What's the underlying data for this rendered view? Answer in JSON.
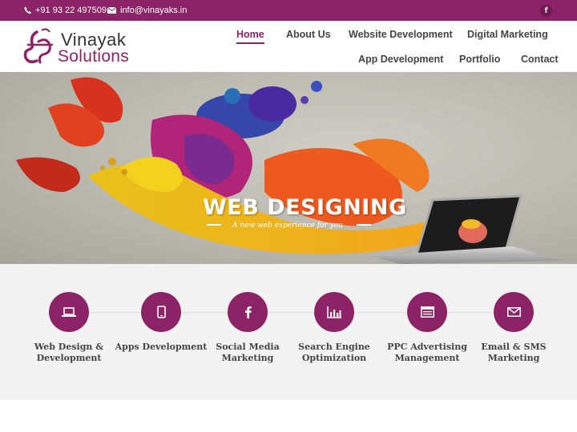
{
  "topbar": {
    "phone": "+91 93 22 497509",
    "email": "info@vinayaks.in",
    "facebook_glyph": "f"
  },
  "logo": {
    "line1": "Vinayak",
    "line2": "Solutions"
  },
  "nav": {
    "items": [
      {
        "label": "Home",
        "active": true
      },
      {
        "label": "About Us"
      },
      {
        "label": "Website Development"
      },
      {
        "label": "Digital Marketing"
      },
      {
        "label": "App Development"
      },
      {
        "label": "Portfolio"
      },
      {
        "label": "Contact"
      }
    ]
  },
  "hero": {
    "title": "WEB DESIGNING",
    "subtitle": "A new web experience for you"
  },
  "services": [
    {
      "label": "Web Design & Development",
      "icon": "laptop-icon"
    },
    {
      "label": "Apps Development",
      "icon": "mobile-icon"
    },
    {
      "label": "Social Media Marketing",
      "icon": "facebook-icon"
    },
    {
      "label": "Search Engine Optimization",
      "icon": "bar-chart-icon"
    },
    {
      "label": "PPC Advertising Management",
      "icon": "browser-window-icon"
    },
    {
      "label": "Email & SMS Marketing",
      "icon": "envelope-icon"
    }
  ],
  "colors": {
    "brand": "#8c2366",
    "text": "#444444",
    "services_bg": "#f2f2f2"
  }
}
